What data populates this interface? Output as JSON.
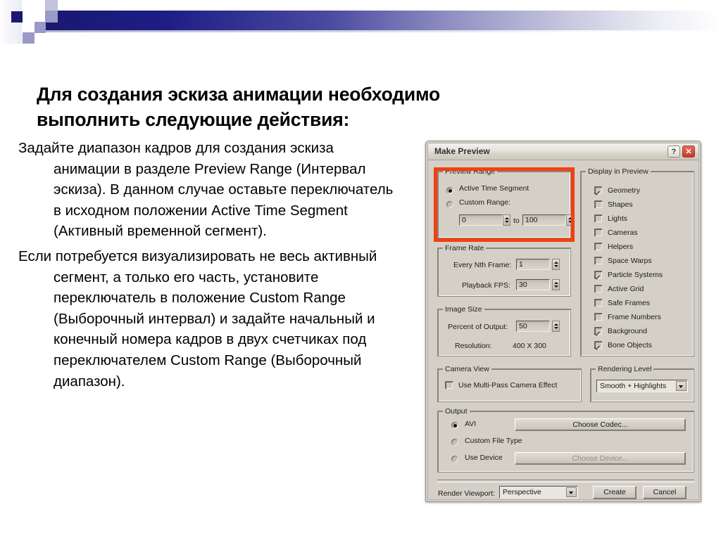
{
  "slide": {
    "title": "Для создания эскиза анимации необходимо выполнить следующие действия:",
    "paragraphs": [
      "Задайте диапазон кадров для создания эскиза анимации в разделе Preview Range (Интервал эскиза). В данном случае оставьте переключатель в исходном положении Active Time Segment (Активный временной сегмент).",
      "Если потребуется визуализировать не весь активный сегмент, а только его часть, установите переключатель в положение Custom Range (Выборочный интервал) и задайте начальный и конечный номера кадров в двух счетчиках под переключателем Custom Range (Выборочный диапазон)."
    ]
  },
  "dialog": {
    "title": "Make Preview",
    "help_button": "?",
    "close_button": "✕",
    "highlight_color": "#f2400f",
    "preview_range": {
      "legend": "Preview Range",
      "options": [
        {
          "label": "Active Time Segment",
          "selected": true
        },
        {
          "label": "Custom Range:",
          "selected": false
        }
      ],
      "from_value": "0",
      "to_label": "to",
      "to_value": "100"
    },
    "frame_rate": {
      "legend": "Frame Rate",
      "every_nth_frame_label": "Every Nth Frame:",
      "every_nth_frame_value": "1",
      "playback_fps_label": "Playback FPS:",
      "playback_fps_value": "30"
    },
    "image_size": {
      "legend": "Image Size",
      "percent_label": "Percent of Output:",
      "percent_value": "50",
      "resolution_label": "Resolution:",
      "resolution_value": "400  X  300"
    },
    "camera_view": {
      "legend": "Camera View",
      "multipass_label": "Use Multi-Pass Camera Effect",
      "multipass_checked": false
    },
    "display_in_preview": {
      "legend": "Display in Preview",
      "items": [
        {
          "label": "Geometry",
          "checked": true
        },
        {
          "label": "Shapes",
          "checked": false
        },
        {
          "label": "Lights",
          "checked": false
        },
        {
          "label": "Cameras",
          "checked": false
        },
        {
          "label": "Helpers",
          "checked": false
        },
        {
          "label": "Space Warps",
          "checked": false
        },
        {
          "label": "Particle Systems",
          "checked": true
        },
        {
          "label": "Active Grid",
          "checked": false
        },
        {
          "label": "Safe Frames",
          "checked": false
        },
        {
          "label": "Frame Numbers",
          "checked": false
        },
        {
          "label": "Background",
          "checked": true
        },
        {
          "label": "Bone Objects",
          "checked": true
        }
      ]
    },
    "rendering_level": {
      "legend": "Rendering Level",
      "selected": "Smooth + Highlights"
    },
    "output": {
      "legend": "Output",
      "options": [
        {
          "label": "AVI",
          "selected": true
        },
        {
          "label": "Custom File Type",
          "selected": false
        },
        {
          "label": "Use Device",
          "selected": false
        }
      ],
      "choose_codec": "Choose Codec...",
      "choose_device": "Choose Device..."
    },
    "footer": {
      "render_viewport_label": "Render Viewport:",
      "render_viewport_value": "Perspective",
      "create_button": "Create",
      "cancel_button": "Cancel"
    }
  }
}
